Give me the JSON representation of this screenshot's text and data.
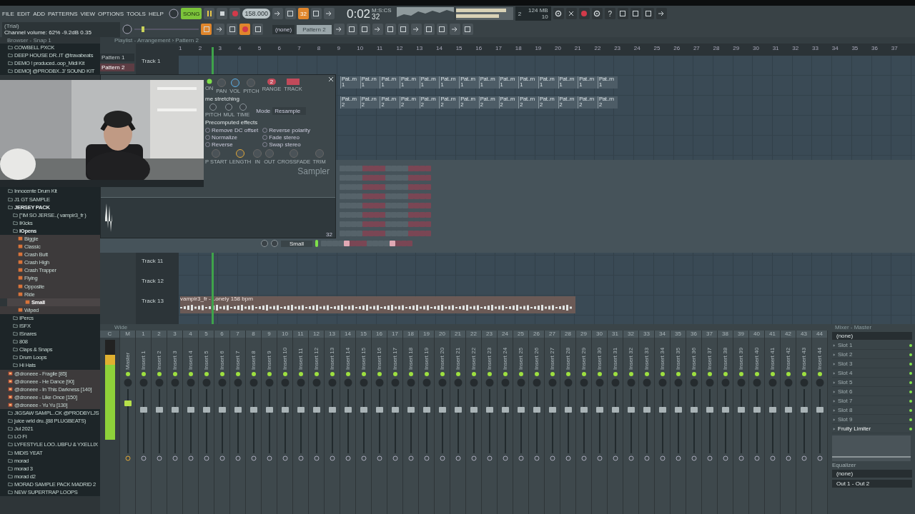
{
  "toolbar": {
    "menu": [
      "FILE",
      "EDIT",
      "ADD",
      "PATTERNS",
      "VIEW",
      "OPTIONS",
      "TOOLS",
      "HELP"
    ],
    "hint": {
      "title": "(Trial)",
      "text": "Channel volume: 62%  -9.2dB  0.35"
    },
    "song_mode": {
      "label": "SONG",
      "selected": true
    },
    "tempo": "158.000",
    "pitch": {
      "level": 0.12
    },
    "step_button": {
      "label": "32",
      "on": true
    },
    "time": {
      "main": "0:02",
      "small": "32",
      "unit": "M:S:CS"
    },
    "memory": {
      "cpu": "2",
      "ram": "124 MB",
      "polyphony": "10"
    },
    "pattern": {
      "channel": "(none)",
      "name": "Pattern 2"
    },
    "help": "?"
  },
  "browser": {
    "title": "Browser - Snap 1",
    "items_top": [
      {
        "kind": "folder",
        "label": "COWBELL PXCK"
      },
      {
        "kind": "folder",
        "label": "DEEP HOUSE DR..IT @travabeats"
      },
      {
        "kind": "folder",
        "label": "DEMO ! produced..oop_Midi Kit"
      },
      {
        "kind": "folder",
        "label": "DEMO] @PRODBX..3' SOUND KIT"
      }
    ],
    "items": [
      {
        "kind": "folder",
        "label": "Innocente Drum Kit"
      },
      {
        "kind": "folder",
        "label": "J1 GT SAMPLE"
      },
      {
        "kind": "folder",
        "label": "JERSEY PACK",
        "expanded": true,
        "children": [
          {
            "kind": "folder",
            "label": "[\"IM SO JERSE..( vampir3_fr )"
          },
          {
            "kind": "folder",
            "label": "IKicks"
          },
          {
            "kind": "folder",
            "label": "IOpens",
            "expanded": true,
            "children": [
              {
                "kind": "sound",
                "label": "Biggie",
                "selected": false
              },
              {
                "kind": "sound",
                "label": "Classic",
                "selected": false
              },
              {
                "kind": "sound",
                "label": "Crash Butt",
                "selected": false
              },
              {
                "kind": "sound",
                "label": "Crash High",
                "selected": false
              },
              {
                "kind": "sound",
                "label": "Crash Trapper",
                "selected": false
              },
              {
                "kind": "sound",
                "label": "Flying",
                "selected": false
              },
              {
                "kind": "sound",
                "label": "Opposite",
                "selected": false
              },
              {
                "kind": "sound",
                "label": "Ride",
                "selected": false
              },
              {
                "kind": "sound",
                "label": "Small",
                "selected": true
              },
              {
                "kind": "sound",
                "label": "Wiped",
                "selected": false
              }
            ]
          },
          {
            "kind": "folder",
            "label": "IPercs"
          },
          {
            "kind": "folder",
            "label": "ISFX"
          },
          {
            "kind": "folder",
            "label": "ISnares"
          },
          {
            "kind": "folder",
            "label": "808"
          },
          {
            "kind": "folder",
            "label": "Claps & Snaps"
          },
          {
            "kind": "folder",
            "label": "Drum Loops"
          },
          {
            "kind": "folder",
            "label": "Hi Hats"
          }
        ]
      },
      {
        "kind": "project",
        "label": "@droneee - Fragile [85]"
      },
      {
        "kind": "project",
        "label": "@droneee - He Dance [90]"
      },
      {
        "kind": "project",
        "label": "@droneee - In This Darkness [140]"
      },
      {
        "kind": "project",
        "label": "@droneee - Like Once [150]"
      },
      {
        "kind": "project",
        "label": "@droneee - Yu Yu [130]"
      },
      {
        "kind": "folder",
        "label": "JIGSAW SAMPL..CK @PRODBYLJS"
      },
      {
        "kind": "folder",
        "label": "juice wrld dru..[88 PLUGBEATS)"
      },
      {
        "kind": "folder",
        "label": "Jul 2021"
      },
      {
        "kind": "folder",
        "label": "LO FI"
      },
      {
        "kind": "folder",
        "label": "LYFESTYLE LOO..UBFU & YXELLIX"
      },
      {
        "kind": "folder",
        "label": "MIDIS YEAT"
      },
      {
        "kind": "folder",
        "label": "morad"
      },
      {
        "kind": "folder",
        "label": "morad 3"
      },
      {
        "kind": "folder",
        "label": "morad d2"
      },
      {
        "kind": "folder",
        "label": "MORAD SAMPLE PACK MADRID 2"
      },
      {
        "kind": "folder",
        "label": "NEW SUPERTRAP LOOPS"
      }
    ]
  },
  "playlist": {
    "title": "Playlist - Arrangement › Pattern 2",
    "patterns": [
      {
        "label": "Pattern 1",
        "selected": false
      },
      {
        "label": "Pattern 2",
        "selected": true
      }
    ],
    "ruler": [
      "1",
      "2",
      "3",
      "4",
      "5",
      "6",
      "7",
      "8",
      "9",
      "10",
      "11",
      "12",
      "13",
      "14",
      "15",
      "16",
      "17",
      "18",
      "19",
      "20",
      "21",
      "22",
      "23",
      "24",
      "25",
      "26",
      "27",
      "28",
      "29",
      "30",
      "31",
      "32",
      "33",
      "34",
      "35",
      "36",
      "37"
    ],
    "tracks_top": [
      {
        "label": "Track 1"
      },
      {
        "clips": [
          "Pat..rn 1",
          "Pat..rn 1",
          "Pat..rn 1",
          "Pat..rn 1",
          "Pat..rn 1",
          "Pat..rn 1",
          "Pat..rn 1",
          "Pat..rn 1",
          "Pat..rn 1",
          "Pat..rn 1",
          "Pat..rn 1",
          "Pat..rn 1",
          "Pat..rn 1",
          "Pat..rn 1"
        ]
      },
      {
        "clips": [
          "Pat..rn 2",
          "Pat..rn 2",
          "Pat..rn 2",
          "Pat..rn 2",
          "Pat..rn 2",
          "Pat..rn 2",
          "Pat..rn 2",
          "Pat..rn 2",
          "Pat..rn 2",
          "Pat..rn 2",
          "Pat..rn 2",
          "Pat..rn 2",
          "Pat..rn 2",
          "Pat..rn 2"
        ]
      }
    ],
    "tracks_bottom": [
      {
        "label": "Track 11"
      },
      {
        "label": "Track 12"
      },
      {
        "label": "Track 13",
        "audio": "vampir3_fr - Lonely 158 bpm"
      }
    ]
  },
  "channel_rack": {
    "channel": {
      "name": "Small",
      "steps": [
        false,
        false,
        false,
        false,
        true,
        false,
        false,
        false,
        false,
        false,
        false,
        false,
        true,
        false,
        false,
        false
      ]
    }
  },
  "sampler": {
    "title": "Sampler",
    "knobs": [
      "ON",
      "PAN",
      "VOL",
      "PITCH"
    ],
    "range": {
      "value": "2",
      "label": "RANGE"
    },
    "track_label": "TRACK",
    "section": "me stretching",
    "mode_label": "Mode",
    "mode": "Resample",
    "stretch_knobs": [
      "PITCH",
      "MUL",
      "TIME"
    ],
    "effects_title": "Precomputed effects",
    "effects": [
      {
        "label": "Remove DC offset",
        "checked": false
      },
      {
        "label": "Reverse polarity",
        "checked": false
      },
      {
        "label": "Normalize",
        "checked": false
      },
      {
        "label": "Fade stereo",
        "checked": false
      },
      {
        "label": "Reverse",
        "checked": false
      },
      {
        "label": "Swap stereo",
        "checked": false
      }
    ],
    "env_knobs": [
      "P START",
      "LENGTH",
      "IN",
      "OUT",
      "CROSSFADE",
      "TRIM"
    ],
    "zoom": "32"
  },
  "mixer": {
    "title": "Wide",
    "meter": {
      "level": 0.85
    },
    "master": {
      "number": "M",
      "name": "Master",
      "level": 0.8
    },
    "current": "C",
    "inserts": [
      {
        "number": "1",
        "name": "Insert 1"
      },
      {
        "number": "2",
        "name": "Insert 2"
      },
      {
        "number": "3",
        "name": "Insert 3"
      },
      {
        "number": "4",
        "name": "Insert 4"
      },
      {
        "number": "5",
        "name": "Insert 5"
      },
      {
        "number": "6",
        "name": "Insert 6"
      },
      {
        "number": "7",
        "name": "Insert 7"
      },
      {
        "number": "8",
        "name": "Insert 8"
      },
      {
        "number": "9",
        "name": "Insert 9"
      },
      {
        "number": "10",
        "name": "Insert 10"
      },
      {
        "number": "11",
        "name": "Insert 11"
      },
      {
        "number": "12",
        "name": "Insert 12"
      },
      {
        "number": "13",
        "name": "Insert 13"
      },
      {
        "number": "14",
        "name": "Insert 14"
      },
      {
        "number": "15",
        "name": "Insert 15"
      },
      {
        "number": "16",
        "name": "Insert 16"
      },
      {
        "number": "17",
        "name": "Insert 17"
      },
      {
        "number": "18",
        "name": "Insert 18"
      },
      {
        "number": "19",
        "name": "Insert 19"
      },
      {
        "number": "20",
        "name": "Insert 20"
      },
      {
        "number": "21",
        "name": "Insert 21"
      },
      {
        "number": "22",
        "name": "Insert 22"
      },
      {
        "number": "23",
        "name": "Insert 23"
      },
      {
        "number": "24",
        "name": "Insert 24"
      },
      {
        "number": "25",
        "name": "Insert 25"
      },
      {
        "number": "26",
        "name": "Insert 26"
      },
      {
        "number": "27",
        "name": "Insert 27"
      },
      {
        "number": "28",
        "name": "Insert 28"
      },
      {
        "number": "29",
        "name": "Insert 29"
      },
      {
        "number": "30",
        "name": "Insert 30"
      },
      {
        "number": "31",
        "name": "Insert 31"
      },
      {
        "number": "32",
        "name": "Insert 32"
      },
      {
        "number": "33",
        "name": "Insert 33"
      },
      {
        "number": "34",
        "name": "Insert 34"
      },
      {
        "number": "35",
        "name": "Insert 35"
      },
      {
        "number": "36",
        "name": "Insert 36"
      },
      {
        "number": "37",
        "name": "Insert 37"
      },
      {
        "number": "38",
        "name": "Insert 38"
      },
      {
        "number": "39",
        "name": "Insert 39"
      },
      {
        "number": "40",
        "name": "Insert 40"
      },
      {
        "number": "41",
        "name": "Insert 41"
      },
      {
        "number": "42",
        "name": "Insert 42"
      },
      {
        "number": "43",
        "name": "Insert 43"
      },
      {
        "number": "44",
        "name": "Insert 44"
      }
    ]
  },
  "mixer_master": {
    "title": "Mixer - Master",
    "input": "(none)",
    "slots": [
      {
        "label": "Slot 1",
        "on": true
      },
      {
        "label": "Slot 2",
        "on": true
      },
      {
        "label": "Slot 3",
        "on": true
      },
      {
        "label": "Slot 4",
        "on": true
      },
      {
        "label": "Slot 5",
        "on": true
      },
      {
        "label": "Slot 6",
        "on": true
      },
      {
        "label": "Slot 7",
        "on": true
      },
      {
        "label": "Slot 8",
        "on": true
      },
      {
        "label": "Slot 9",
        "on": true
      },
      {
        "label": "Fruity Limiter",
        "on": true
      }
    ],
    "eq_label": "Equalizer",
    "send": "(none)",
    "output": "Out 1 - Out 2"
  }
}
